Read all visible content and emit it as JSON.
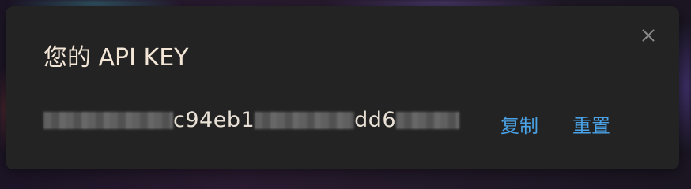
{
  "dialog": {
    "title": "您的 API KEY",
    "close_icon": "close-icon"
  },
  "api_key": {
    "visible_segments": [
      "c94eb1",
      "dd6"
    ]
  },
  "actions": {
    "copy_label": "复制",
    "reset_label": "重置"
  },
  "colors": {
    "modal_bg": "#232323",
    "title_text": "#f3e6d7",
    "link_blue": "#4aa3e8"
  }
}
